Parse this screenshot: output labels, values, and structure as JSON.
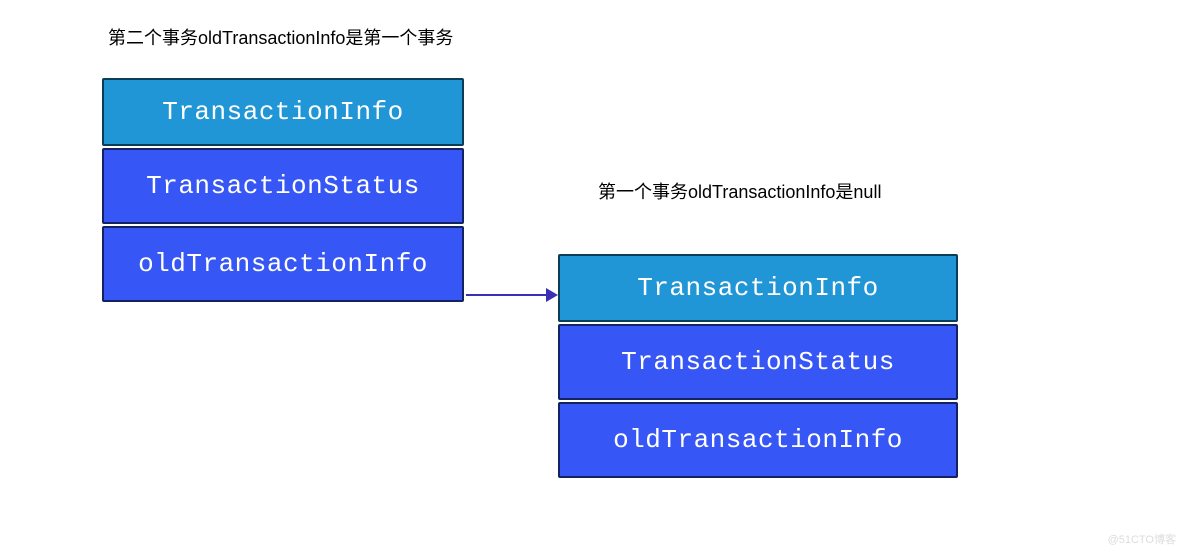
{
  "captions": {
    "left": "第二个事务oldTransactionInfo是第一个事务",
    "right": "第一个事务oldTransactionInfo是null"
  },
  "leftStack": {
    "header": "TransactionInfo",
    "row1": "TransactionStatus",
    "row2": "oldTransactionInfo"
  },
  "rightStack": {
    "header": "TransactionInfo",
    "row1": "TransactionStatus",
    "row2": "oldTransactionInfo"
  },
  "watermark": "@51CTO博客"
}
